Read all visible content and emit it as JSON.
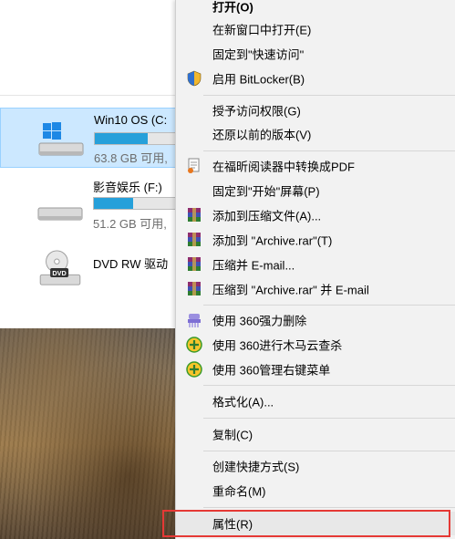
{
  "drives": [
    {
      "name": "Win10 OS (C:",
      "free": "63.8 GB 可用,",
      "usage": 0.6,
      "selected": true
    },
    {
      "name": "影音娱乐 (F:)",
      "free": "51.2 GB 可用,",
      "usage": 0.45,
      "selected": false
    },
    {
      "name": "DVD RW 驱动",
      "icon_text": "DVD",
      "selected": false
    }
  ],
  "menu": {
    "open": "打开(O)",
    "open_new_window": "在新窗口中打开(E)",
    "pin_quick_access": "固定到\"快速访问\"",
    "bitlocker": "启用 BitLocker(B)",
    "grant_access": "授予访问权限(G)",
    "restore_versions": "还原以前的版本(V)",
    "foxit_pdf": "在福昕阅读器中转换成PDF",
    "pin_start": "固定到\"开始\"屏幕(P)",
    "add_archive": "添加到压缩文件(A)...",
    "add_archive_rar": "添加到 \"Archive.rar\"(T)",
    "compress_email": "压缩并 E-mail...",
    "compress_rar_email": "压缩到 \"Archive.rar\" 并 E-mail",
    "del_360": "使用 360强力删除",
    "scan_360": "使用 360进行木马云查杀",
    "manage_360": "使用 360管理右键菜单",
    "format": "格式化(A)...",
    "copy": "复制(C)",
    "create_shortcut": "创建快捷方式(S)",
    "rename": "重命名(M)",
    "properties": "属性(R)"
  },
  "colors": {
    "selection": "#cce8ff",
    "bar_fill": "#26a0da",
    "highlight": "#e53935",
    "menu_bg": "#f2f2f2"
  }
}
